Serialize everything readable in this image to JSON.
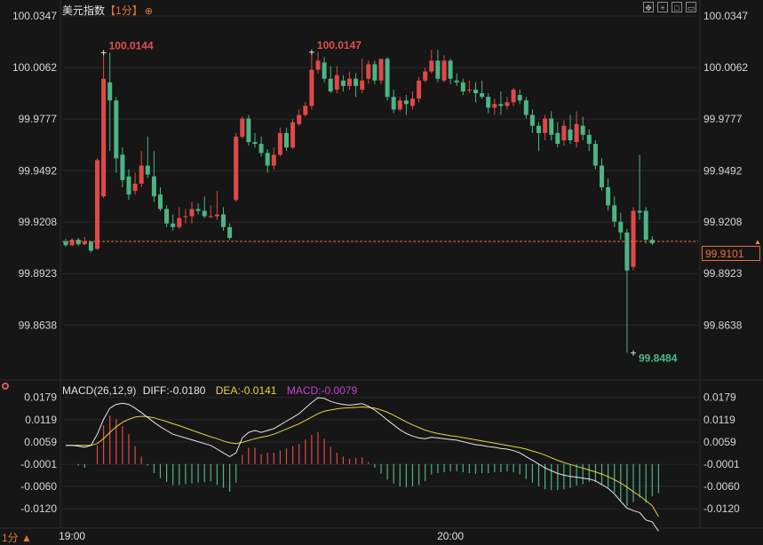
{
  "header": {
    "symbol": "美元指数",
    "period": "【1分】",
    "settings_icon": "gear-icon",
    "toolbar_icons": [
      "move-icon",
      "crosshair-icon",
      "expand-icon",
      "collapse-icon"
    ]
  },
  "colors": {
    "up": "#e04848",
    "down": "#4bb486",
    "diff_line": "#e8e8e8",
    "dea_line": "#e5d83a",
    "current_price": "#e3733a"
  },
  "footer": {
    "period_switch": "1分 ▲"
  },
  "current_price_label": "99.9101",
  "chart_data": [
    {
      "type": "candlestick",
      "yticks": [
        "100.0347",
        "100.0062",
        "99.9777",
        "99.9492",
        "99.9208",
        "99.8923",
        "99.8638"
      ],
      "ylim": [
        99.835,
        100.0347
      ],
      "xticks": [
        {
          "label": "19:00",
          "index": 1
        },
        {
          "label": "20:00",
          "index": 61
        }
      ],
      "current_price": 99.9101,
      "annotations": [
        {
          "text": "100.0144",
          "index": 6,
          "value": 100.0144,
          "kind": "high"
        },
        {
          "text": "100.0147",
          "index": 39,
          "value": 100.0147,
          "kind": "high"
        },
        {
          "text": "99.8484",
          "index": 90,
          "value": 99.8484,
          "kind": "low"
        }
      ],
      "candles": [
        [
          99.91,
          99.908,
          99.9115,
          99.907
        ],
        [
          99.908,
          99.911,
          99.912,
          99.9075
        ],
        [
          99.911,
          99.9085,
          99.912,
          99.9075
        ],
        [
          99.9085,
          99.91,
          99.9125,
          99.908
        ],
        [
          99.91,
          99.905,
          99.9105,
          99.904
        ],
        [
          99.906,
          99.955,
          99.956,
          99.9055
        ],
        [
          99.935,
          100.0,
          100.0144,
          99.934
        ],
        [
          99.998,
          99.988,
          100.0144,
          99.96
        ],
        [
          99.988,
          99.956,
          99.99,
          99.948
        ],
        [
          99.958,
          99.944,
          99.962,
          99.94
        ],
        [
          99.946,
          99.936,
          99.95,
          99.933
        ],
        [
          99.938,
          99.942,
          99.948,
          99.936
        ],
        [
          99.942,
          99.952,
          99.96,
          99.94
        ],
        [
          99.952,
          99.947,
          99.968,
          99.945
        ],
        [
          99.946,
          99.935,
          99.96,
          99.932
        ],
        [
          99.936,
          99.928,
          99.94,
          99.927
        ],
        [
          99.928,
          99.92,
          99.93,
          99.918
        ],
        [
          99.92,
          99.918,
          99.925,
          99.916
        ],
        [
          99.918,
          99.923,
          99.929,
          99.917
        ],
        [
          99.924,
          99.924,
          99.928,
          99.92
        ],
        [
          99.924,
          99.928,
          99.932,
          99.92
        ],
        [
          99.928,
          99.927,
          99.931,
          99.925
        ],
        [
          99.927,
          99.924,
          99.935,
          99.923
        ],
        [
          99.924,
          99.924,
          99.93,
          99.923
        ],
        [
          99.924,
          99.925,
          99.938,
          99.922
        ],
        [
          99.925,
          99.918,
          99.929,
          99.916
        ],
        [
          99.918,
          99.912,
          99.92,
          99.911
        ],
        [
          99.933,
          99.968,
          99.97,
          99.932
        ],
        [
          99.968,
          99.978,
          99.979,
          99.967
        ],
        [
          99.978,
          99.965,
          99.98,
          99.963
        ],
        [
          99.965,
          99.964,
          99.97,
          99.962
        ],
        [
          99.964,
          99.959,
          99.968,
          99.957
        ],
        [
          99.959,
          99.952,
          99.961,
          99.948
        ],
        [
          99.952,
          99.958,
          99.962,
          99.95
        ],
        [
          99.958,
          99.97,
          99.973,
          99.957
        ],
        [
          99.97,
          99.962,
          99.973,
          99.96
        ],
        [
          99.962,
          99.976,
          99.978,
          99.961
        ],
        [
          99.975,
          99.98,
          99.983,
          99.974
        ],
        [
          99.98,
          99.985,
          99.987,
          99.979
        ],
        [
          99.985,
          100.005,
          100.0147,
          99.983
        ],
        [
          100.005,
          100.01,
          100.0147,
          100.003
        ],
        [
          100.009,
          100.0,
          100.012,
          99.998
        ],
        [
          100.0,
          99.993,
          100.007,
          99.992
        ],
        [
          99.994,
          100.002,
          100.007,
          99.992
        ],
        [
          99.999,
          99.996,
          100.002,
          99.993
        ],
        [
          99.996,
          100.0,
          100.004,
          99.994
        ],
        [
          100.0,
          99.996,
          100.003,
          99.99
        ],
        [
          99.994,
          99.999,
          100.011,
          99.992
        ],
        [
          100.0,
          100.008,
          100.01,
          99.997
        ],
        [
          100.008,
          99.999,
          100.01,
          99.997
        ],
        [
          99.999,
          100.011,
          100.011,
          99.997
        ],
        [
          100.011,
          99.99,
          100.012,
          99.988
        ],
        [
          99.99,
          99.983,
          99.994,
          99.981
        ],
        [
          99.983,
          99.988,
          99.99,
          99.982
        ],
        [
          99.988,
          99.986,
          99.991,
          99.98
        ],
        [
          99.985,
          99.989,
          99.993,
          99.983
        ],
        [
          99.989,
          99.999,
          100.001,
          99.987
        ],
        [
          99.999,
          100.004,
          100.006,
          99.998
        ],
        [
          100.004,
          100.01,
          100.016,
          100.003
        ],
        [
          100.01,
          100.0,
          100.016,
          99.998
        ],
        [
          99.999,
          100.01,
          100.013,
          99.998
        ],
        [
          100.01,
          100.0,
          100.011,
          99.997
        ],
        [
          99.999,
          99.998,
          100.003,
          99.996
        ],
        [
          99.998,
          99.993,
          100.0,
          99.991
        ],
        [
          99.994,
          99.994,
          99.999,
          99.992
        ],
        [
          99.994,
          99.992,
          99.998,
          99.987
        ],
        [
          99.992,
          99.99,
          99.999,
          99.989
        ],
        [
          99.99,
          99.984,
          99.992,
          99.981
        ],
        [
          99.984,
          99.986,
          99.989,
          99.98
        ],
        [
          99.986,
          99.985,
          99.993,
          99.98
        ],
        [
          99.985,
          99.987,
          99.99,
          99.983
        ],
        [
          99.987,
          99.994,
          99.995,
          99.985
        ],
        [
          99.991,
          99.988,
          99.994,
          99.986
        ],
        [
          99.988,
          99.98,
          99.99,
          99.978
        ],
        [
          99.98,
          99.974,
          99.983,
          99.97
        ],
        [
          99.974,
          99.97,
          99.976,
          99.96
        ],
        [
          99.97,
          99.978,
          99.98,
          99.966
        ],
        [
          99.978,
          99.969,
          99.982,
          99.966
        ],
        [
          99.97,
          99.964,
          99.976,
          99.962
        ],
        [
          99.966,
          99.974,
          99.977,
          99.963
        ],
        [
          99.972,
          99.966,
          99.98,
          99.964
        ],
        [
          99.965,
          99.975,
          99.982,
          99.962
        ],
        [
          99.974,
          99.969,
          99.979,
          99.966
        ],
        [
          99.969,
          99.964,
          99.972,
          99.96
        ],
        [
          99.964,
          99.952,
          99.966,
          99.95
        ],
        [
          99.952,
          99.94,
          99.956,
          99.938
        ],
        [
          99.94,
          99.93,
          99.945,
          99.927
        ],
        [
          99.93,
          99.921,
          99.935,
          99.918
        ],
        [
          99.921,
          99.915,
          99.926,
          99.911
        ],
        [
          99.915,
          99.894,
          99.917,
          99.8484
        ],
        [
          99.896,
          99.927,
          99.929,
          99.894
        ],
        [
          99.927,
          99.926,
          99.958,
          99.922
        ],
        [
          99.927,
          99.911,
          99.929,
          99.909
        ],
        [
          99.911,
          99.909,
          99.913,
          99.908
        ]
      ]
    },
    {
      "type": "macd",
      "params": "MACD(26,12,9)",
      "diff_label": "DIFF:-0.0180",
      "dea_label": "DEA:-0.0141",
      "macd_label": "MACD:-0.0079",
      "yticks": [
        "0.0179",
        "0.0119",
        "0.0059",
        "-0.0001",
        "-0.0060",
        "-0.0120"
      ],
      "ylim": [
        -0.016,
        0.019
      ],
      "diff": [
        0.005,
        0.005,
        0.0048,
        0.0045,
        0.005,
        0.008,
        0.012,
        0.015,
        0.016,
        0.0163,
        0.016,
        0.015,
        0.0138,
        0.0125,
        0.0112,
        0.01,
        0.009,
        0.008,
        0.0075,
        0.007,
        0.0065,
        0.006,
        0.0055,
        0.005,
        0.004,
        0.003,
        0.002,
        0.003,
        0.007,
        0.0085,
        0.009,
        0.0085,
        0.009,
        0.0095,
        0.0105,
        0.0115,
        0.0125,
        0.0135,
        0.015,
        0.0165,
        0.0178,
        0.0176,
        0.0168,
        0.0163,
        0.016,
        0.0158,
        0.016,
        0.0162,
        0.0155,
        0.0145,
        0.0132,
        0.0118,
        0.0105,
        0.0092,
        0.0082,
        0.0075,
        0.007,
        0.0068,
        0.0072,
        0.007,
        0.0068,
        0.0066,
        0.0064,
        0.006,
        0.0056,
        0.0052,
        0.005,
        0.0047,
        0.0045,
        0.0042,
        0.004,
        0.0036,
        0.003,
        0.002,
        0.001,
        0.0,
        -0.001,
        -0.0018,
        -0.0025,
        -0.003,
        -0.0033,
        -0.0035,
        -0.0038,
        -0.004,
        -0.0045,
        -0.0055,
        -0.0065,
        -0.008,
        -0.01,
        -0.0118,
        -0.0125,
        -0.013,
        -0.015,
        -0.0155,
        -0.018
      ],
      "dea": [
        0.005,
        0.005,
        0.005,
        0.005,
        0.005,
        0.0055,
        0.0068,
        0.0085,
        0.01,
        0.0112,
        0.012,
        0.0126,
        0.0128,
        0.0127,
        0.0124,
        0.0119,
        0.0114,
        0.0108,
        0.0103,
        0.0097,
        0.0091,
        0.0085,
        0.0079,
        0.0073,
        0.0068,
        0.0062,
        0.0057,
        0.0055,
        0.0058,
        0.0063,
        0.0068,
        0.0072,
        0.0075,
        0.008,
        0.0087,
        0.0094,
        0.0101,
        0.0108,
        0.0117,
        0.0126,
        0.0135,
        0.0142,
        0.0145,
        0.0148,
        0.015,
        0.0151,
        0.0152,
        0.0153,
        0.0152,
        0.015,
        0.0145,
        0.0139,
        0.0131,
        0.0122,
        0.0113,
        0.0105,
        0.0098,
        0.0091,
        0.0086,
        0.0082,
        0.0079,
        0.0076,
        0.0074,
        0.0071,
        0.0068,
        0.0065,
        0.0062,
        0.0059,
        0.0056,
        0.0053,
        0.005,
        0.0047,
        0.0044,
        0.004,
        0.0035,
        0.003,
        0.0024,
        0.0017,
        0.001,
        0.0004,
        -0.0001,
        -0.0006,
        -0.0011,
        -0.0016,
        -0.0021,
        -0.0027,
        -0.0034,
        -0.0042,
        -0.0051,
        -0.0062,
        -0.0074,
        -0.0085,
        -0.0098,
        -0.0112,
        -0.0141
      ]
    }
  ]
}
